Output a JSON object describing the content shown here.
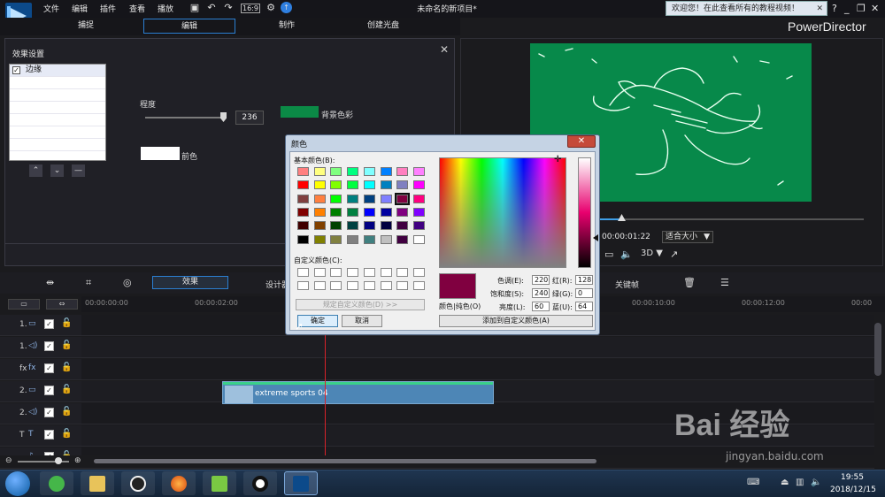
{
  "app": {
    "title": "未命名的新项目*",
    "brand": "PowerDirector",
    "menu": [
      "文件",
      "编辑",
      "插件",
      "查看",
      "播放"
    ],
    "welcome": "欢迎您！在此查看所有的教程视频！",
    "window_controls": [
      "?",
      "_",
      "❐",
      "✕"
    ]
  },
  "modes": {
    "tabs": [
      "捕捉",
      "编辑",
      "制作",
      "创建光盘"
    ],
    "active": "编辑"
  },
  "effect_panel": {
    "title": "效果设置",
    "list_items": [
      "边缘"
    ],
    "degree_label": "程度",
    "degree_value": "236",
    "degree_fraction": 0.92,
    "bg_label": "背景色彩",
    "bg_color": "#0b8a46",
    "fg_label": "前色",
    "fg_color": "#ffffff"
  },
  "preview": {
    "timecode": "00:00:01:22",
    "fit": "适合大小",
    "fit_arrow": "▼",
    "mode_3d": "3D ▼"
  },
  "toolbar": {
    "effect": "效果",
    "design": "设计器",
    "keyframe": "关键帧"
  },
  "ruler": {
    "ticks": [
      "00:00:00:00",
      "00:00:02:00",
      "00:00:10:00",
      "00:00:12:00",
      "00:00"
    ]
  },
  "tracks": [
    {
      "label": "1.",
      "icon": "video-track-icon"
    },
    {
      "label": "1.",
      "icon": "audio-track-icon"
    },
    {
      "label": "fx",
      "icon": "fx-track-icon"
    },
    {
      "label": "2.",
      "icon": "video-track-icon"
    },
    {
      "label": "2.",
      "icon": "audio-track-icon"
    },
    {
      "label": "T",
      "icon": "title-track-icon"
    },
    {
      "label": "",
      "icon": "voice-track-icon"
    }
  ],
  "clip": {
    "name": "extreme sports 04"
  },
  "color_dialog": {
    "title": "颜色",
    "basic_label": "基本颜色(B):",
    "custom_label": "自定义颜色(C):",
    "define_button": "规定自定义颜色(D) >>",
    "ok": "确定",
    "cancel": "取消",
    "color_solid": "颜色|纯色(O)",
    "add_button": "添加到自定义颜色(A)",
    "hue_label": "色调(E):",
    "hue": "220",
    "sat_label": "饱和度(S):",
    "sat": "240",
    "lum_label": "亮度(L):",
    "lum": "60",
    "red_label": "红(R):",
    "red": "128",
    "green_label": "绿(G):",
    "green": "0",
    "blue_label": "蓝(U):",
    "blue": "64",
    "current_color": "#800040",
    "basic_colors": [
      "#ff8080",
      "#ffff80",
      "#80ff80",
      "#00ff80",
      "#80ffff",
      "#0080ff",
      "#ff80c0",
      "#ff80ff",
      "#ff0000",
      "#ffff00",
      "#80ff00",
      "#00ff40",
      "#00ffff",
      "#0080c0",
      "#8080c0",
      "#ff00ff",
      "#804040",
      "#ff8040",
      "#00ff00",
      "#008080",
      "#004080",
      "#8080ff",
      "#800040",
      "#ff0080",
      "#800000",
      "#ff8000",
      "#008000",
      "#008040",
      "#0000ff",
      "#0000a0",
      "#800080",
      "#8000ff",
      "#400000",
      "#804000",
      "#004000",
      "#004040",
      "#000080",
      "#000040",
      "#400040",
      "#400080",
      "#000000",
      "#808000",
      "#808040",
      "#808080",
      "#408080",
      "#c0c0c0",
      "#400040",
      "#ffffff"
    ],
    "selected_index": 22
  },
  "taskbar": {
    "time": "19:55",
    "date": "2018/12/15"
  },
  "watermark": {
    "text": "Bai 经验",
    "url": "jingyan.baidu.com"
  }
}
